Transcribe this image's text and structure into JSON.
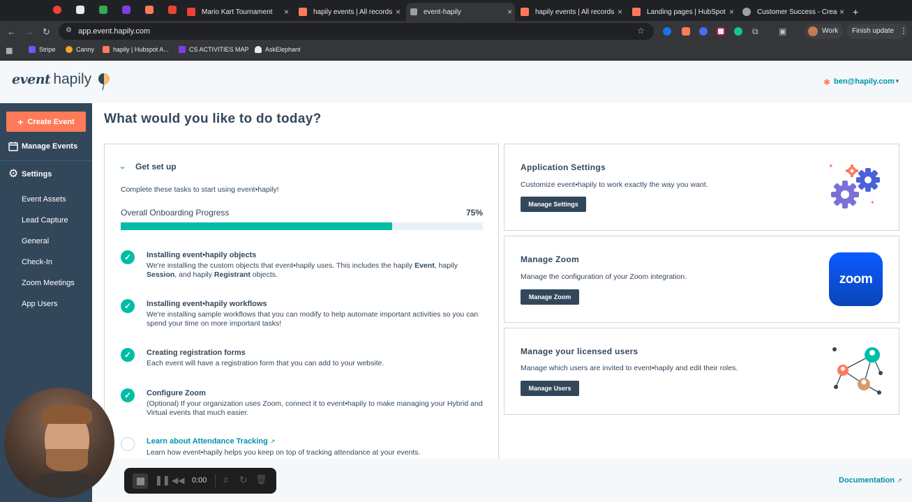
{
  "browser": {
    "tabs": [
      {
        "label": "Mario Kart Tournament",
        "color": "#ea4335"
      },
      {
        "label": "hapily events | All records",
        "color": "#ff7a59"
      },
      {
        "label": "event-hapily",
        "color": "#9aa0a6"
      },
      {
        "label": "hapily events | All records",
        "color": "#ff7a59"
      },
      {
        "label": "Landing pages | HubSpot",
        "color": "#ff7a59"
      },
      {
        "label": "Customer Success - Crea",
        "color": "#9aa0a6"
      }
    ],
    "new_tab": "+",
    "url": "app.event.hapily.com",
    "profile": "Work",
    "finish_update": "Finish update",
    "bookmarks": [
      {
        "label": "Stripe",
        "color": "#635bff"
      },
      {
        "label": "Canny",
        "color": "#f5a623"
      },
      {
        "label": "hapily | Hubspot A...",
        "color": "#ff7a59"
      },
      {
        "label": "CS ACTIVITIES MAP",
        "color": "#7b3fe4"
      },
      {
        "label": "AskElephant",
        "color": "#e8eaed"
      }
    ]
  },
  "app": {
    "logo_text_1": "event",
    "logo_text_2": "hapily",
    "user_email": "ben@hapily.com",
    "create_event": "Create Event",
    "manage_events": "Manage Events",
    "settings": "Settings",
    "settings_items": [
      "Event Assets",
      "Lead Capture",
      "General",
      "Check-In",
      "Zoom Meetings",
      "App Users"
    ],
    "page_title": "What would you like to do today?",
    "setup": {
      "title": "Get set up",
      "intro": "Complete these tasks to start using event•hapily!",
      "progress_label": "Overall Onboarding Progress",
      "progress_text": "75%",
      "progress_value": 0.75,
      "tasks": [
        {
          "title": "Installing event•hapily objects",
          "desc_1": "We're installing the custom objects that event•hapily uses. This includes the hapily ",
          "bold_1": "Event",
          "desc_2": ", hapily",
          "bold_2": "Session",
          "desc_3": ", and hapily ",
          "bold_3": "Registrant",
          "desc_4": " objects."
        },
        {
          "title": "Installing event•hapily workflows",
          "desc": "We're installing sample workflows that you can modify to help automate important activities so you can spend your time on more important tasks!"
        },
        {
          "title": "Creating registration forms",
          "desc": "Each event will have a registration form that you can add to your website."
        },
        {
          "title": "Configure Zoom",
          "desc": "(Optional) If your organization uses Zoom, connect it to event•hapily to make managing your Hybrid and Virtual events that much easier."
        },
        {
          "title": "Learn about Attendance Tracking",
          "desc": "Learn how event•hapily helps you keep on top of tracking attendance at your events."
        }
      ]
    },
    "cards": [
      {
        "title": "Application Settings",
        "desc": "Customize event•hapily to work exactly the way you want.",
        "button": "Manage Settings"
      },
      {
        "title": "Manage Zoom",
        "desc": "Manage the configuration of your Zoom integration.",
        "button": "Manage Zoom",
        "logo": "zoom"
      },
      {
        "title": "Manage your licensed users",
        "desc": "Manage which users are invited to event•hapily and edit their roles.",
        "button": "Manage Users"
      }
    ],
    "documentation": "Documentation"
  },
  "recorder": {
    "time": "0:00"
  },
  "colors": {
    "accent": "#ff7a59",
    "teal": "#00bda5",
    "sidebar": "#33475b",
    "link": "#0091ae",
    "zoom": "#0b5cff"
  }
}
